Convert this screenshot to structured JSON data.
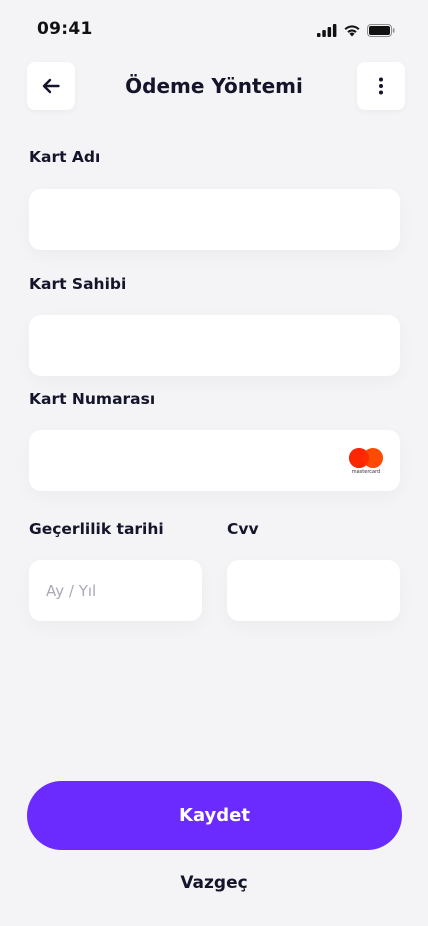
{
  "status_bar": {
    "time": "09:41",
    "icons": [
      "signal-icon",
      "wifi-icon",
      "battery-icon"
    ]
  },
  "header": {
    "title": "Ödeme Yöntemi",
    "back_icon": "arrow-left-icon",
    "menu_icon": "more-vertical-icon"
  },
  "form": {
    "card_name": {
      "label": "Kart Adı",
      "value": "",
      "placeholder": ""
    },
    "card_holder": {
      "label": "Kart Sahibi",
      "value": "",
      "placeholder": ""
    },
    "card_number": {
      "label": "Kart Numarası",
      "value": "",
      "placeholder": "",
      "brand": "mastercard"
    },
    "expiry": {
      "label": "Geçerlilik tarihi",
      "value": "",
      "placeholder": "Ay / Yıl"
    },
    "cvv": {
      "label": "Cvv",
      "value": "",
      "placeholder": ""
    }
  },
  "actions": {
    "save_label": "Kaydet",
    "cancel_label": "Vazgeç"
  },
  "colors": {
    "background": "#f4f4f6",
    "accent": "#6b2bff",
    "text": "#14142b",
    "mastercard_red": "#eb001b",
    "mastercard_orange": "#ff5f00"
  }
}
